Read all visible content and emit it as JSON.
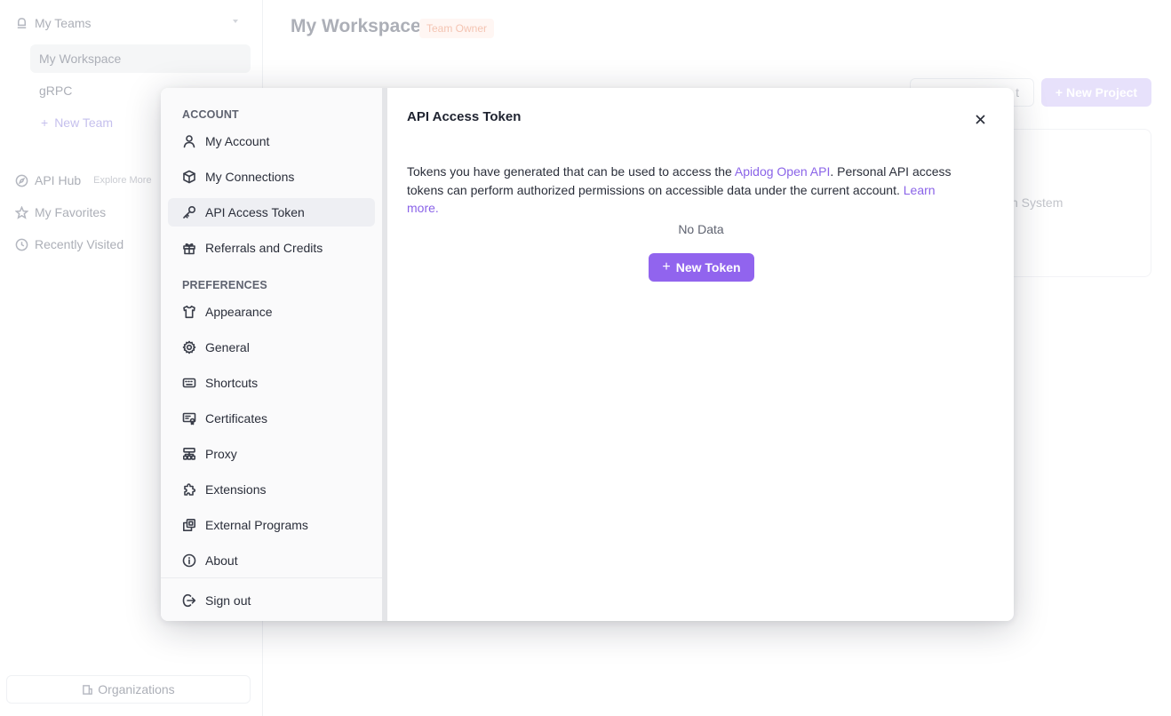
{
  "background": {
    "sidebar": {
      "my_teams": "My Teams",
      "teams": [
        "My Workspace",
        "gRPC"
      ],
      "new_team": "New Team",
      "api_hub": "API Hub",
      "explore_more": "Explore More",
      "my_favorites": "My Favorites",
      "recently_visited": "Recently Visited",
      "organizations": "Organizations"
    },
    "header": {
      "title": "My Workspace",
      "badge": "Team Owner",
      "import_button_partial": "t",
      "new_project_button": "+ New Project"
    },
    "card_partial_text": "n System"
  },
  "modal": {
    "nav": {
      "account_header": "ACCOUNT",
      "account_items": [
        "My Account",
        "My Connections",
        "API Access Token",
        "Referrals and Credits"
      ],
      "preferences_header": "PREFERENCES",
      "preference_items": [
        "Appearance",
        "General",
        "Shortcuts",
        "Certificates",
        "Proxy",
        "Extensions",
        "External Programs",
        "About"
      ],
      "sign_out": "Sign out",
      "active_item": "API Access Token"
    },
    "main": {
      "title": "API Access Token",
      "desc_part1": "Tokens you have generated that can be used to access the ",
      "desc_link1": "Apidog Open API",
      "desc_part2": ". Personal API access tokens can perform authorized permissions on accessible data under the current account. ",
      "desc_link2": "Learn more.",
      "empty_text": "No Data",
      "new_token_button": "New Token"
    },
    "accent_color": "#9164ee"
  }
}
